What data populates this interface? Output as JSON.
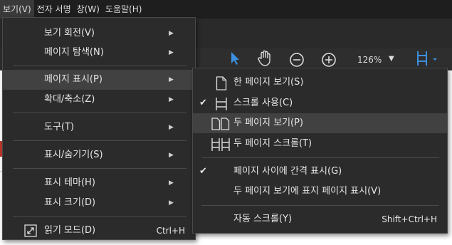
{
  "menubar": {
    "items": [
      {
        "label": "보기(V)"
      },
      {
        "label": "전자 서명"
      },
      {
        "label": "창(W)"
      },
      {
        "label": "도움말(H)"
      }
    ]
  },
  "toolbar": {
    "zoom_value": "126%",
    "zoom_caret": "▼"
  },
  "main_menu": {
    "items": [
      {
        "label": "보기 회전(V)",
        "arrow": "▶"
      },
      {
        "label": "페이지 탐색(N)",
        "arrow": "▶"
      },
      {
        "label": "페이지 표시(P)",
        "arrow": "▶"
      },
      {
        "label": "확대/축소(Z)",
        "arrow": "▶"
      },
      {
        "label": "도구(T)",
        "arrow": "▶"
      },
      {
        "label": "표시/숨기기(S)",
        "arrow": "▶"
      },
      {
        "label": "표시 테마(H)",
        "arrow": "▶"
      },
      {
        "label": "표시 크기(D)",
        "arrow": "▶"
      },
      {
        "label": "읽기 모드(D)",
        "shortcut": "Ctrl+H"
      }
    ]
  },
  "sub_menu": {
    "items": [
      {
        "label": "한 페이지 보기(S)"
      },
      {
        "label": "스크롤 사용(C)",
        "check": "✔"
      },
      {
        "label": "두 페이지 보기(P)"
      },
      {
        "label": "두 페이지 스크롤(T)"
      },
      {
        "label": "페이지 사이에 간격 표시(G)",
        "check": "✔"
      },
      {
        "label": "두 페이지 보기에 표지 페이지 표시(V)"
      },
      {
        "label": "자동 스크롤(Y)",
        "shortcut": "Shift+Ctrl+H"
      }
    ]
  },
  "colors": {
    "menu_bg": "#2b2b2b",
    "highlight": "#414141",
    "accent_blue": "#3d8fe0"
  }
}
